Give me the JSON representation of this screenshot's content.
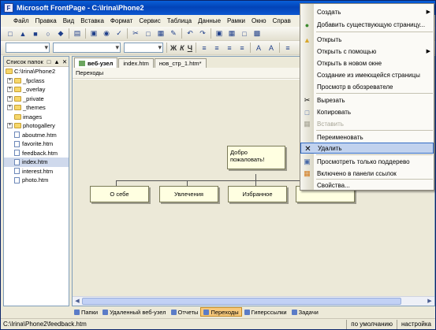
{
  "window": {
    "title": "Microsoft FrontPage - C:\\Irina\\Phone2",
    "app_icon": "frontpage-icon"
  },
  "menubar": [
    "Файл",
    "Правка",
    "Вид",
    "Вставка",
    "Формат",
    "Сервис",
    "Таблица",
    "Данные",
    "Рамки",
    "Окно",
    "Справ"
  ],
  "toolbar2": {
    "bold": "Ж",
    "italic": "К",
    "underline": "Ч"
  },
  "folder_list": {
    "title": "Список папок",
    "root": "C:\\Irina\\Phone2",
    "folders": [
      "_fpclass",
      "_overlay",
      "_private",
      "_themes",
      "images",
      "photogallery"
    ],
    "files": [
      "aboutme.htm",
      "favorite.htm",
      "feedback.htm",
      "index.htm",
      "interest.htm",
      "photo.htm"
    ],
    "selected": "index.htm"
  },
  "tabs": [
    "веб-узел",
    "index.htm",
    "нов_стр_1.htm*"
  ],
  "view_header": "Переходы",
  "navigation": {
    "home": "Добро пожаловать!",
    "children": [
      "О себе",
      "Увлечения",
      "Избранное",
      ""
    ]
  },
  "viewbar": [
    "Папки",
    "Удаленный веб-узел",
    "Отчеты",
    "Переходы",
    "Гиперссылки",
    "Задачи"
  ],
  "viewbar_active": "Переходы",
  "statusbar": {
    "path": "C:\\Irina\\Phone2\\feedback.htm",
    "mode": "по умолчанию",
    "setting": "настройка"
  },
  "context_menu": {
    "items": [
      {
        "label": "Создать",
        "submenu": true
      },
      {
        "label": "Добавить существующую страницу...",
        "icon": "add-page-icon"
      },
      {
        "label": "Открыть",
        "icon": "open-folder-icon"
      },
      {
        "label": "Открыть с помощью",
        "submenu": true
      },
      {
        "label": "Открыть в новом окне"
      },
      {
        "label": "Создание из имеющейся страницы"
      },
      {
        "label": "Просмотр в обозревателе"
      },
      {
        "label": "Вырезать",
        "icon": "cut-icon"
      },
      {
        "label": "Копировать",
        "icon": "copy-icon"
      },
      {
        "label": "Вставить",
        "icon": "paste-icon",
        "disabled": true
      },
      {
        "label": "Переименовать"
      },
      {
        "label": "Удалить",
        "icon": "delete-icon",
        "highlighted": true
      },
      {
        "label": "Просмотреть только поддерево",
        "icon": "subtree-icon"
      },
      {
        "label": "Включено в панели ссылок",
        "icon": "link-bar-icon"
      },
      {
        "label": "Свойства..."
      }
    ]
  }
}
